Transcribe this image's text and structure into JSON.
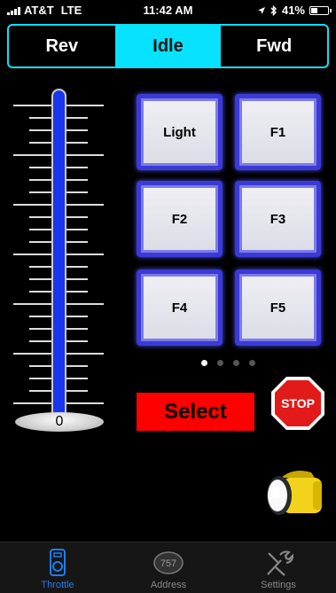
{
  "status_bar": {
    "carrier": "AT&T",
    "network": "LTE",
    "time": "11:42 AM",
    "battery": "41%",
    "battery_level": 0.41
  },
  "direction": {
    "options": [
      "Rev",
      "Idle",
      "Fwd"
    ],
    "selected": "Idle"
  },
  "throttle": {
    "value": "0"
  },
  "functions": [
    "Light",
    "F1",
    "F2",
    "F3",
    "F4",
    "F5"
  ],
  "pager": {
    "pages": 4,
    "current": 1
  },
  "select_label": "Select",
  "stop_label": "STOP",
  "tabs": [
    {
      "label": "Throttle",
      "icon": "throttle-icon",
      "active": true
    },
    {
      "label": "Address",
      "icon": "address-757-icon",
      "badge": "757",
      "active": false
    },
    {
      "label": "Settings",
      "icon": "wrench-icon",
      "active": false
    }
  ],
  "colors": {
    "accent": "#06e2ff",
    "button_border": "#3b3ad8",
    "throttle_rail": "#1a35f0",
    "select": "#ff0000",
    "tab_active": "#1a7ff0"
  }
}
